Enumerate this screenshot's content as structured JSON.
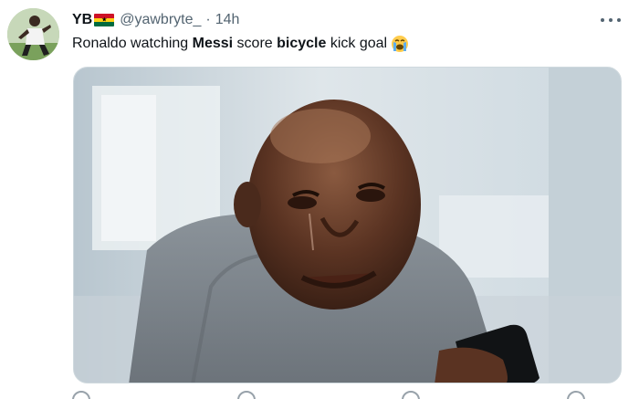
{
  "tweet": {
    "author_name": "YB",
    "flag_icon": "ghana-flag-icon",
    "handle": "@yawbryte_",
    "separator": "·",
    "timestamp": "14h",
    "text_parts": [
      "Ronaldo watching ",
      "Messi",
      " score ",
      "bicycle",
      " kick goal"
    ],
    "emoji": "loudly-crying-face-icon",
    "media_description_icon": "meme-photo"
  },
  "colors": {
    "text_primary": "#0f1419",
    "text_secondary": "#536471",
    "border": "#cfd9de"
  }
}
